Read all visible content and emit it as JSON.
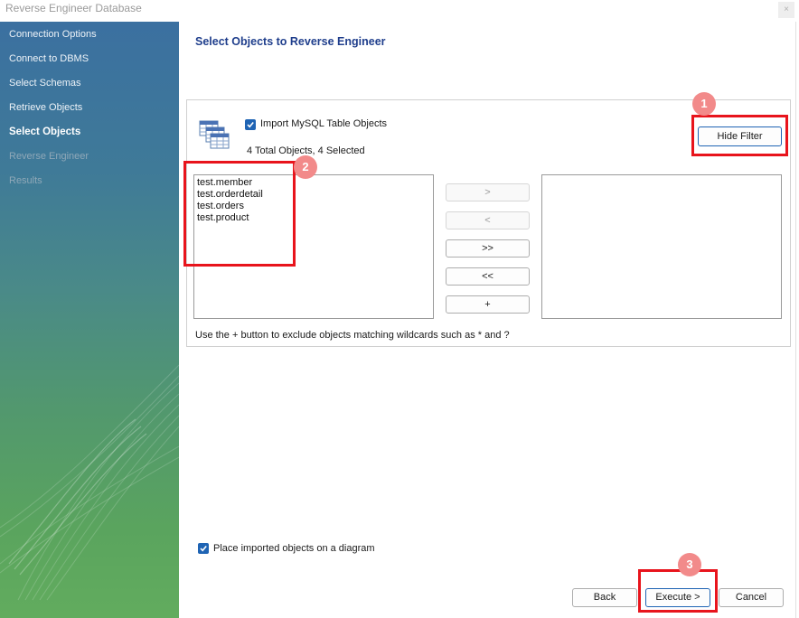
{
  "window": {
    "title": "Reverse Engineer Database",
    "close_glyph": "×"
  },
  "sidebar": {
    "steps": [
      {
        "label": "Connection Options",
        "state": "done"
      },
      {
        "label": "Connect to DBMS",
        "state": "done"
      },
      {
        "label": "Select Schemas",
        "state": "done"
      },
      {
        "label": "Retrieve Objects",
        "state": "done"
      },
      {
        "label": "Select Objects",
        "state": "active"
      },
      {
        "label": "Reverse Engineer",
        "state": "pending"
      },
      {
        "label": "Results",
        "state": "pending"
      }
    ]
  },
  "main": {
    "heading": "Select Objects to Reverse Engineer",
    "import_checkbox": {
      "label": "Import MySQL Table Objects",
      "checked": true
    },
    "summary": "4 Total Objects, 4 Selected",
    "hide_filter_label": "Hide Filter",
    "left_list": [
      "test.member",
      "test.orderdetail",
      "test.orders",
      "test.product"
    ],
    "right_list": [],
    "transfer_buttons": [
      {
        "label": ">",
        "enabled": false
      },
      {
        "label": "<",
        "enabled": false
      },
      {
        "label": ">>",
        "enabled": true
      },
      {
        "label": "<<",
        "enabled": true
      },
      {
        "label": "+",
        "enabled": true
      }
    ],
    "hint": "Use the + button to exclude objects matching wildcards such as * and ?",
    "place_checkbox": {
      "label": "Place imported objects on a diagram",
      "checked": true
    }
  },
  "footer": {
    "back_label": "Back",
    "execute_label": "Execute >",
    "cancel_label": "Cancel"
  },
  "annotations": {
    "markers": [
      "1",
      "2",
      "3"
    ],
    "highlight_color": "#e8141c",
    "marker_color": "#f28a8a"
  }
}
